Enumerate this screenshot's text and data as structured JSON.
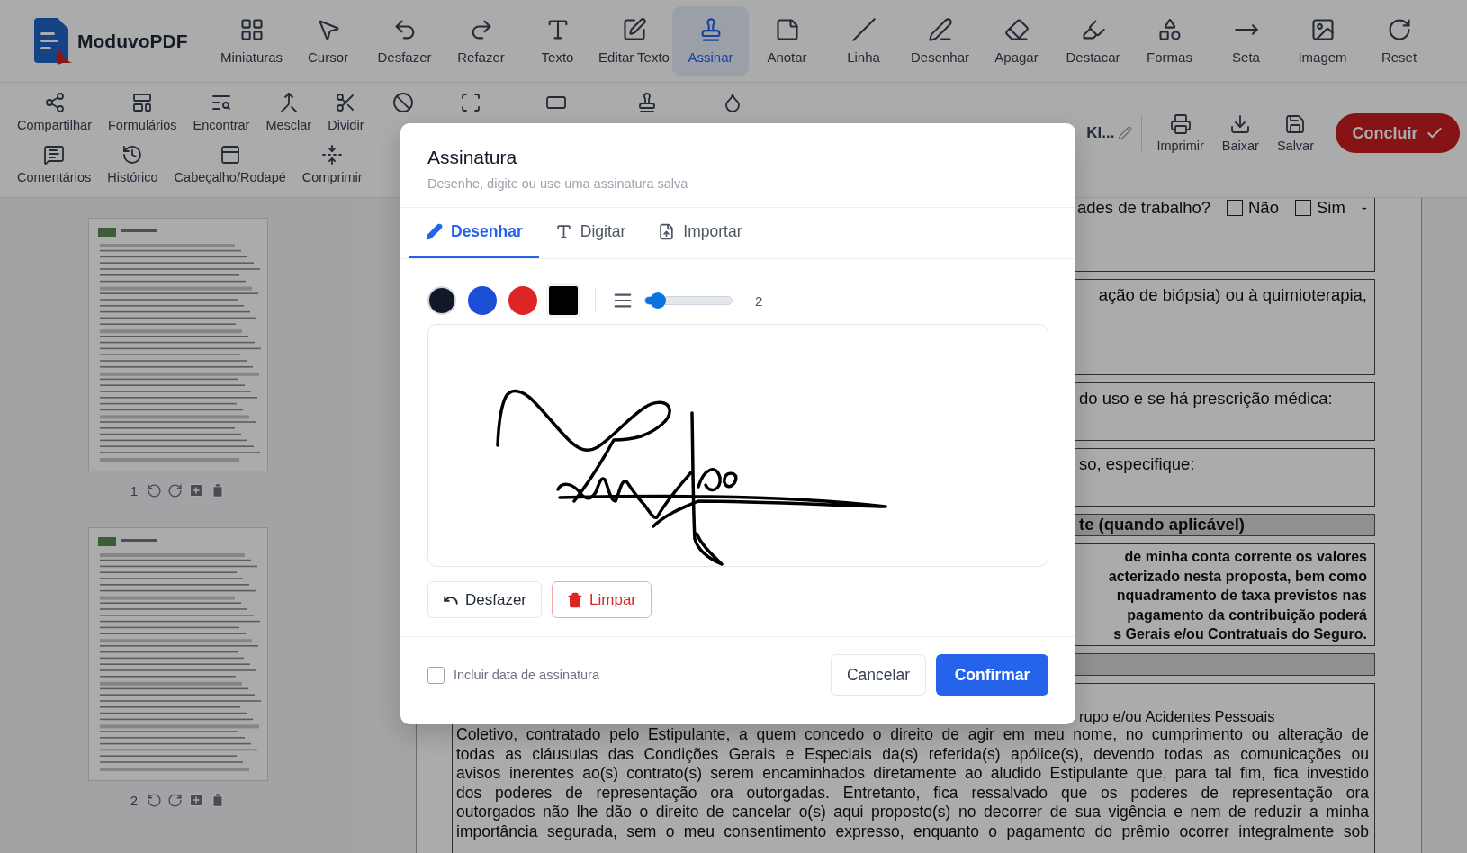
{
  "app": {
    "name": "ModuvoPDF"
  },
  "toolbar": [
    {
      "label": "Miniaturas",
      "selected": false
    },
    {
      "label": "Cursor",
      "selected": false
    },
    {
      "label": "Desfazer",
      "selected": false
    },
    {
      "label": "Refazer",
      "selected": false
    },
    {
      "label": "Texto",
      "selected": false
    },
    {
      "label": "Editar Texto",
      "selected": false
    },
    {
      "label": "Assinar",
      "selected": true
    },
    {
      "label": "Anotar",
      "selected": false
    },
    {
      "label": "Linha",
      "selected": false
    },
    {
      "label": "Desenhar",
      "selected": false
    },
    {
      "label": "Apagar",
      "selected": false
    },
    {
      "label": "Destacar",
      "selected": false
    },
    {
      "label": "Formas",
      "selected": false
    },
    {
      "label": "Seta",
      "selected": false
    },
    {
      "label": "Imagem",
      "selected": false
    },
    {
      "label": "Reset",
      "selected": false
    }
  ],
  "tools_row_1": [
    "Compartilhar",
    "Formulários",
    "Encontrar",
    "Mesclar",
    "Dividir"
  ],
  "tools_row_2": [
    "Comentários",
    "Histórico",
    "Cabeçalho/Rodapé",
    "Comprimir"
  ],
  "document_name": "Kl...",
  "actions": [
    "Imprimir",
    "Baixar",
    "Salvar"
  ],
  "finish_button": "Concluir",
  "thumbnails": [
    {
      "page": "1"
    },
    {
      "page": "2"
    }
  ],
  "document": {
    "question_1": {
      "text": "ades de trabalho?",
      "options": [
        {
          "label": "Não",
          "checked": false
        },
        {
          "label": "Sim",
          "checked": false
        }
      ],
      "suffix": "-"
    },
    "question_2": "ação de biópsia) ou à quimioterapia,",
    "question_3": "do uso e se há prescrição médica:",
    "question_4": "so, especifique:",
    "section_header": "te (quando aplicável)",
    "bold_lines": [
      "de minha conta corrente os valores",
      "acterizado nesta proposta, bem como",
      "nquadramento de taxa previstos nas",
      "pagamento da contribuição poderá",
      "s Gerais e/ou Contratuais do Seguro."
    ],
    "section_2_title": "rupo e/ou Acidentes Pessoais",
    "paragraph_lines": [
      "Coletivo, contratado pelo Estipulante, a quem concedo o direito de agir em meu nome, no cumprimento ou alteração de",
      "todas as cláusulas das Condições Gerais e Especiais da(s) referida(s) apólice(s), devendo todas as comunicações ou",
      "avisos inerentes ao(s) contrato(s) serem encaminhados diretamente ao aludido Estipulante que, para tal fim, fica investido",
      "dos poderes de representação ora outorgadas. Entretanto, fica ressalvado que os poderes de representação ora",
      "outorgados não lhe dão o direito de cancelar o(s) aqui proposto(s) no decorrer de sua vigência e nem de reduzir a minha",
      "importância segurada, sem o meu consentimento expresso, enquanto o pagamento do prêmio ocorrer integralmente sob"
    ]
  },
  "modal": {
    "title": "Assinatura",
    "subtitle": "Desenhe, digite ou use uma assinatura salva",
    "tabs": [
      {
        "label": "Desenhar",
        "selected": true
      },
      {
        "label": "Digitar",
        "selected": false
      },
      {
        "label": "Importar",
        "selected": false
      }
    ],
    "colors": [
      {
        "kind": "swatch",
        "color": "#111827",
        "selected": true
      },
      {
        "kind": "swatch",
        "color": "#1d4ed8",
        "selected": false
      },
      {
        "kind": "swatch",
        "color": "#dc2626",
        "selected": false
      },
      {
        "kind": "custom",
        "color": "#000000",
        "selected": false
      }
    ],
    "stroke": {
      "level": 0.15,
      "value": "2"
    },
    "undo_button": "Desfazer",
    "clear_button": "Limpar",
    "include_date": {
      "label": "Incluir data de assinatura",
      "checked": false
    },
    "cancel_button": "Cancelar",
    "confirm_button": "Confirmar"
  }
}
